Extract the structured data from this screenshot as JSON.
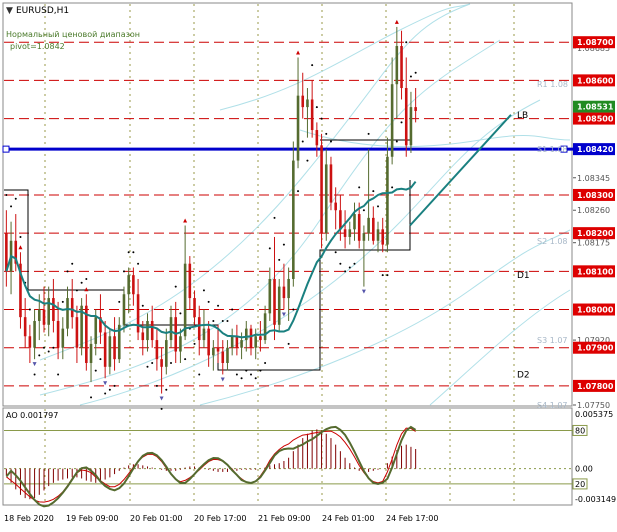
{
  "header": {
    "symbol": "EURUSD,H1",
    "indicator_name": "Нормальный ценовой диапазон",
    "pivot_label": "pivot=1.0842"
  },
  "colors": {
    "background": "#ffffff",
    "bull_candle": "#556b2f",
    "bear_candle": "#cc1111",
    "level_line": "#cc0000",
    "pivot_line": "#0000cc",
    "moving_average": "#1a8080",
    "channel_lines": "#b0e0e8",
    "psar_dots": "#000000",
    "pivot_box": "#000000",
    "price_badge": "#dd0000",
    "current_price_badge": "#228b22",
    "ao_histogram": "#800000",
    "ao_fast_line": "#cc0000",
    "ao_slow_line": "#556b2f"
  },
  "chart_data": [
    {
      "type": "candlestick",
      "symbol": "EURUSD",
      "timeframe": "H1",
      "ylim": [
        1.0775,
        1.088
      ],
      "x_ticks": [
        "18 Feb 2020",
        "19 Feb 09:00",
        "20 Feb 01:00",
        "20 Feb 17:00",
        "21 Feb 09:00",
        "24 Feb 01:00",
        "24 Feb 17:00"
      ],
      "y_ticks": [
        "1.08685",
        "1.08600",
        "1.08500",
        "1.08420",
        "1.08345",
        "1.08300",
        "1.08260",
        "1.08200",
        "1.08175",
        "1.08100",
        "1.08000",
        "1.07920",
        "1.07900",
        "1.07800",
        "1.07750"
      ],
      "price_badges": [
        "1.08700",
        "1.08600",
        "1.08531",
        "1.08500",
        "1.08420",
        "1.08300",
        "1.08200",
        "1.08100",
        "1.08000",
        "1.07900",
        "1.07800"
      ],
      "current_price": "1.08531",
      "pivot": 1.0842,
      "level_lines": [
        1.087,
        1.086,
        1.085,
        1.083,
        1.082,
        1.081,
        1.08,
        1.079,
        1.078
      ],
      "pivot_labels": [
        {
          "text": "R1 1.08",
          "value": 1.0859
        },
        {
          "text": "S1 1.08",
          "value": 1.0842
        },
        {
          "text": "S2 1.08",
          "value": 1.0818
        },
        {
          "text": "S3 1.07",
          "value": 1.0792
        },
        {
          "text": "S4 1.07",
          "value": 1.0775
        }
      ],
      "annotations": [
        {
          "text": "LB",
          "value": 1.0851
        },
        {
          "text": "D1",
          "value": 1.0809
        },
        {
          "text": "D2",
          "value": 1.0783
        }
      ],
      "candles": [
        {
          "o": 1.082,
          "h": 1.0826,
          "l": 1.0806,
          "c": 1.081
        },
        {
          "o": 1.081,
          "h": 1.0823,
          "l": 1.0804,
          "c": 1.0818
        },
        {
          "o": 1.0818,
          "h": 1.0825,
          "l": 1.081,
          "c": 1.0812
        },
        {
          "o": 1.0812,
          "h": 1.0815,
          "l": 1.0795,
          "c": 1.0798
        },
        {
          "o": 1.0798,
          "h": 1.0803,
          "l": 1.079,
          "c": 1.0793
        },
        {
          "o": 1.0793,
          "h": 1.0796,
          "l": 1.0786,
          "c": 1.079
        },
        {
          "o": 1.079,
          "h": 1.08,
          "l": 1.0787,
          "c": 1.0797
        },
        {
          "o": 1.0797,
          "h": 1.0804,
          "l": 1.0792,
          "c": 1.08
        },
        {
          "o": 1.08,
          "h": 1.0806,
          "l": 1.0794,
          "c": 1.0796
        },
        {
          "o": 1.0796,
          "h": 1.0806,
          "l": 1.0793,
          "c": 1.0803
        },
        {
          "o": 1.0803,
          "h": 1.0808,
          "l": 1.0794,
          "c": 1.0797
        },
        {
          "o": 1.0797,
          "h": 1.0802,
          "l": 1.0787,
          "c": 1.079
        },
        {
          "o": 1.079,
          "h": 1.0798,
          "l": 1.0787,
          "c": 1.0795
        },
        {
          "o": 1.0795,
          "h": 1.0806,
          "l": 1.0793,
          "c": 1.0803
        },
        {
          "o": 1.0803,
          "h": 1.0808,
          "l": 1.0795,
          "c": 1.0798
        },
        {
          "o": 1.0798,
          "h": 1.0801,
          "l": 1.0786,
          "c": 1.079
        },
        {
          "o": 1.079,
          "h": 1.0803,
          "l": 1.0788,
          "c": 1.0801
        },
        {
          "o": 1.0801,
          "h": 1.0804,
          "l": 1.0784,
          "c": 1.0786
        },
        {
          "o": 1.0786,
          "h": 1.0793,
          "l": 1.0781,
          "c": 1.0791
        },
        {
          "o": 1.0791,
          "h": 1.08,
          "l": 1.0788,
          "c": 1.0798
        },
        {
          "o": 1.0798,
          "h": 1.0804,
          "l": 1.0791,
          "c": 1.0794
        },
        {
          "o": 1.0794,
          "h": 1.0797,
          "l": 1.0782,
          "c": 1.0785
        },
        {
          "o": 1.0785,
          "h": 1.0795,
          "l": 1.0783,
          "c": 1.0793
        },
        {
          "o": 1.0793,
          "h": 1.0798,
          "l": 1.0784,
          "c": 1.0787
        },
        {
          "o": 1.0787,
          "h": 1.0798,
          "l": 1.0786,
          "c": 1.0796
        },
        {
          "o": 1.0796,
          "h": 1.0806,
          "l": 1.0794,
          "c": 1.0804
        },
        {
          "o": 1.0804,
          "h": 1.0811,
          "l": 1.0799,
          "c": 1.0809
        },
        {
          "o": 1.0809,
          "h": 1.0811,
          "l": 1.0801,
          "c": 1.0804
        },
        {
          "o": 1.0804,
          "h": 1.0808,
          "l": 1.0792,
          "c": 1.0794
        },
        {
          "o": 1.0794,
          "h": 1.0797,
          "l": 1.0788,
          "c": 1.0792
        },
        {
          "o": 1.0792,
          "h": 1.0799,
          "l": 1.0789,
          "c": 1.0797
        },
        {
          "o": 1.0797,
          "h": 1.0801,
          "l": 1.079,
          "c": 1.0792
        },
        {
          "o": 1.0792,
          "h": 1.0795,
          "l": 1.0784,
          "c": 1.0787
        },
        {
          "o": 1.0787,
          "h": 1.079,
          "l": 1.0778,
          "c": 1.0785
        },
        {
          "o": 1.0785,
          "h": 1.0795,
          "l": 1.0783,
          "c": 1.0792
        },
        {
          "o": 1.0792,
          "h": 1.0801,
          "l": 1.079,
          "c": 1.0798
        },
        {
          "o": 1.0798,
          "h": 1.0802,
          "l": 1.0786,
          "c": 1.0789
        },
        {
          "o": 1.0789,
          "h": 1.0795,
          "l": 1.0786,
          "c": 1.0793
        },
        {
          "o": 1.0793,
          "h": 1.0822,
          "l": 1.0792,
          "c": 1.0812
        },
        {
          "o": 1.0812,
          "h": 1.0814,
          "l": 1.08,
          "c": 1.0803
        },
        {
          "o": 1.0803,
          "h": 1.0805,
          "l": 1.0796,
          "c": 1.0798
        },
        {
          "o": 1.0798,
          "h": 1.0801,
          "l": 1.0788,
          "c": 1.0792
        },
        {
          "o": 1.0792,
          "h": 1.08,
          "l": 1.079,
          "c": 1.0795
        },
        {
          "o": 1.0795,
          "h": 1.0797,
          "l": 1.0785,
          "c": 1.0788
        },
        {
          "o": 1.0788,
          "h": 1.0792,
          "l": 1.0784,
          "c": 1.079
        },
        {
          "o": 1.079,
          "h": 1.0796,
          "l": 1.0786,
          "c": 1.0789
        },
        {
          "o": 1.0789,
          "h": 1.0792,
          "l": 1.0783,
          "c": 1.0786
        },
        {
          "o": 1.0786,
          "h": 1.0792,
          "l": 1.0784,
          "c": 1.079
        },
        {
          "o": 1.079,
          "h": 1.0795,
          "l": 1.0788,
          "c": 1.0793
        },
        {
          "o": 1.0793,
          "h": 1.0796,
          "l": 1.0788,
          "c": 1.079
        },
        {
          "o": 1.079,
          "h": 1.0794,
          "l": 1.0787,
          "c": 1.0792
        },
        {
          "o": 1.0792,
          "h": 1.0797,
          "l": 1.0789,
          "c": 1.0795
        },
        {
          "o": 1.0795,
          "h": 1.0796,
          "l": 1.0788,
          "c": 1.079
        },
        {
          "o": 1.079,
          "h": 1.0795,
          "l": 1.0787,
          "c": 1.0793
        },
        {
          "o": 1.0793,
          "h": 1.0797,
          "l": 1.0789,
          "c": 1.0792
        },
        {
          "o": 1.0792,
          "h": 1.0801,
          "l": 1.0791,
          "c": 1.0799
        },
        {
          "o": 1.0799,
          "h": 1.0811,
          "l": 1.0797,
          "c": 1.0808
        },
        {
          "o": 1.0808,
          "h": 1.0819,
          "l": 1.0792,
          "c": 1.0796
        },
        {
          "o": 1.0796,
          "h": 1.0808,
          "l": 1.0794,
          "c": 1.0806
        },
        {
          "o": 1.0806,
          "h": 1.0812,
          "l": 1.08,
          "c": 1.0803
        },
        {
          "o": 1.0803,
          "h": 1.0811,
          "l": 1.0797,
          "c": 1.0808
        },
        {
          "o": 1.0808,
          "h": 1.0844,
          "l": 1.0806,
          "c": 1.0839
        },
        {
          "o": 1.0839,
          "h": 1.0866,
          "l": 1.0837,
          "c": 1.0856
        },
        {
          "o": 1.0856,
          "h": 1.0862,
          "l": 1.085,
          "c": 1.0853
        },
        {
          "o": 1.0853,
          "h": 1.0858,
          "l": 1.0845,
          "c": 1.0855
        },
        {
          "o": 1.0855,
          "h": 1.086,
          "l": 1.0845,
          "c": 1.0847
        },
        {
          "o": 1.0847,
          "h": 1.0849,
          "l": 1.084,
          "c": 1.0843
        },
        {
          "o": 1.0843,
          "h": 1.0846,
          "l": 1.0816,
          "c": 1.082
        },
        {
          "o": 1.082,
          "h": 1.0842,
          "l": 1.0818,
          "c": 1.0838
        },
        {
          "o": 1.0838,
          "h": 1.084,
          "l": 1.0826,
          "c": 1.0828
        },
        {
          "o": 1.0828,
          "h": 1.0832,
          "l": 1.0821,
          "c": 1.0826
        },
        {
          "o": 1.0826,
          "h": 1.083,
          "l": 1.0818,
          "c": 1.0821
        },
        {
          "o": 1.0821,
          "h": 1.0826,
          "l": 1.0816,
          "c": 1.0819
        },
        {
          "o": 1.0819,
          "h": 1.0823,
          "l": 1.0817,
          "c": 1.0821
        },
        {
          "o": 1.0821,
          "h": 1.0828,
          "l": 1.0818,
          "c": 1.0825
        },
        {
          "o": 1.0825,
          "h": 1.0828,
          "l": 1.0816,
          "c": 1.0818
        },
        {
          "o": 1.0818,
          "h": 1.0822,
          "l": 1.0806,
          "c": 1.082
        },
        {
          "o": 1.082,
          "h": 1.0842,
          "l": 1.0818,
          "c": 1.0824
        },
        {
          "o": 1.0824,
          "h": 1.0827,
          "l": 1.0817,
          "c": 1.0818
        },
        {
          "o": 1.0818,
          "h": 1.0823,
          "l": 1.0815,
          "c": 1.0821
        },
        {
          "o": 1.0821,
          "h": 1.0824,
          "l": 1.0815,
          "c": 1.0817
        },
        {
          "o": 1.0817,
          "h": 1.0845,
          "l": 1.0815,
          "c": 1.084
        },
        {
          "o": 1.084,
          "h": 1.0866,
          "l": 1.0838,
          "c": 1.0859
        },
        {
          "o": 1.0859,
          "h": 1.0874,
          "l": 1.085,
          "c": 1.0869
        },
        {
          "o": 1.0869,
          "h": 1.0873,
          "l": 1.0855,
          "c": 1.0858
        },
        {
          "o": 1.0858,
          "h": 1.0866,
          "l": 1.084,
          "c": 1.0843
        },
        {
          "o": 1.0843,
          "h": 1.0857,
          "l": 1.0841,
          "c": 1.0853
        },
        {
          "o": 1.0853,
          "h": 1.0858,
          "l": 1.0849,
          "c": 1.0852
        }
      ]
    },
    {
      "type": "bar",
      "title": "AO 0.001797",
      "ylim": [
        -0.003149,
        0.005375
      ],
      "y_ticks": [
        "0.005375",
        "80",
        "0.00",
        "20",
        "-0.003149"
      ],
      "values": [
        -0.0006,
        -0.0013,
        -0.0019,
        -0.0024,
        -0.0027,
        -0.0028,
        -0.0027,
        -0.0024,
        -0.002,
        -0.0016,
        -0.0013,
        -0.0011,
        -0.001,
        -0.0009,
        -0.0008,
        -0.0008,
        -0.0009,
        -0.0011,
        -0.0012,
        -0.0013,
        -0.0012,
        -0.001,
        -0.0008,
        -0.0005,
        -0.0002,
        0.0001,
        0.0003,
        0.0004,
        0.0004,
        0.0003,
        0.0002,
        0.0001,
        0.0,
        -0.0001,
        -0.0002,
        -0.0002,
        -0.0002,
        -0.0001,
        0.0001,
        0.0002,
        0.0002,
        0.0001,
        0.0,
        -0.0001,
        -0.0002,
        -0.0003,
        -0.0003,
        -0.0003,
        -0.0002,
        -0.0002,
        -0.0001,
        -0.0001,
        -0.0001,
        -0.0001,
        0.0,
        0.0001,
        0.0003,
        0.0004,
        0.0005,
        0.0007,
        0.001,
        0.0016,
        0.0022,
        0.0028,
        0.0032,
        0.0035,
        0.0036,
        0.0035,
        0.0032,
        0.0028,
        0.0022,
        0.0016,
        0.001,
        0.0005,
        0.0001,
        -0.0002,
        -0.0003,
        -0.0003,
        -0.0002,
        -0.0001,
        0.0,
        0.0005,
        0.0011,
        0.0017,
        0.0021,
        0.0022,
        0.002,
        0.0018
      ]
    }
  ]
}
